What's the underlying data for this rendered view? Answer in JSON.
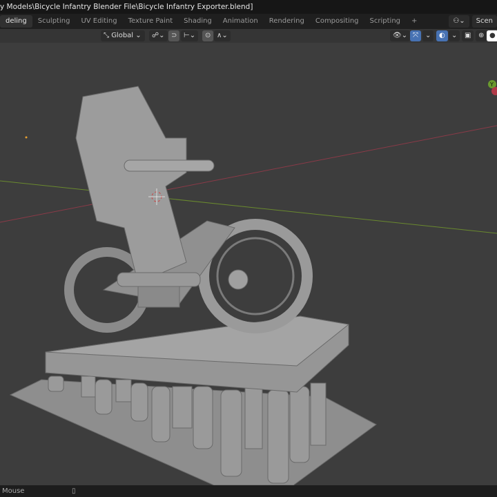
{
  "title": "y Models\\Bicycle Infantry Blender File\\Bicycle Infantry Exporter.blend]",
  "tabs": [
    "deling",
    "Sculpting",
    "UV Editing",
    "Texture Paint",
    "Shading",
    "Animation",
    "Rendering",
    "Compositing",
    "Scripting",
    "+"
  ],
  "active_tab": 0,
  "scene_label": "Scen",
  "header": {
    "orientation": "Global"
  },
  "gizmo": {
    "y_axis": "Y"
  },
  "status": {
    "mouse_label": "Mouse"
  },
  "colors": {
    "viewport": "#3d3d3d",
    "accent": "#4772b3",
    "x_axis": "#8b3a48",
    "y_axis": "#6a8a2e"
  }
}
